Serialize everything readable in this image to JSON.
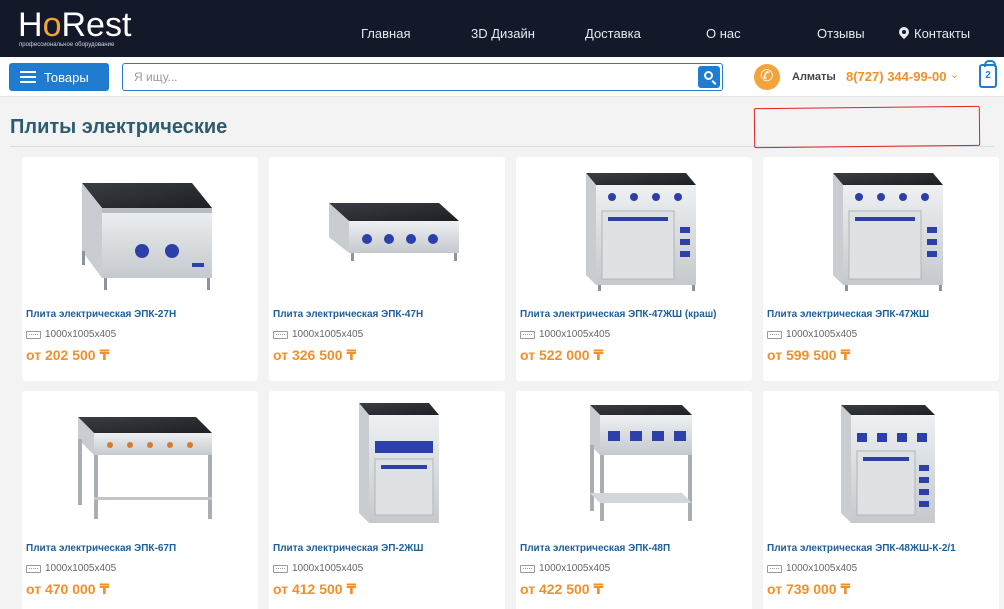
{
  "header": {
    "logo_text": "HoRest",
    "logo_subtitle": "профессиональное оборудование",
    "nav": [
      {
        "label": "Главная"
      },
      {
        "label": "3D Дизайн"
      },
      {
        "label": "Доставка"
      },
      {
        "label": "О нас"
      },
      {
        "label": "Отзывы"
      },
      {
        "label": "Контакты",
        "icon": "map-pin-icon"
      }
    ]
  },
  "toolbar": {
    "goods_label": "Товары",
    "search_placeholder": "Я ищу...",
    "city": "Алматы",
    "phone": "8(727) 344-99-00",
    "cart_count": "2"
  },
  "page": {
    "title": "Плиты электрические"
  },
  "products": [
    {
      "name": "Плита электрическая ЭПК-27Н",
      "dims": "1000х1005х405",
      "price": "от 202 500 ₸"
    },
    {
      "name": "Плита электрическая ЭПК-47Н",
      "dims": "1000х1005х405",
      "price": "от 326 500 ₸"
    },
    {
      "name": "Плита электрическая ЭПК-47ЖШ (краш)",
      "dims": "1000х1005х405",
      "price": "от 522 000 ₸"
    },
    {
      "name": "Плита электрическая ЭПК-47ЖШ",
      "dims": "1000х1005х405",
      "price": "от 599 500 ₸"
    },
    {
      "name": "Плита электрическая ЭПК-67П",
      "dims": "1000х1005х405",
      "price": "от 470 000 ₸"
    },
    {
      "name": "Плита электрическая ЭП-2ЖШ",
      "dims": "1000х1005х405",
      "price": "от 412 500 ₸"
    },
    {
      "name": "Плита электрическая ЭПК-48П",
      "dims": "1000х1005х405",
      "price": "от 422 500 ₸"
    },
    {
      "name": "Плита электрическая ЭПК-48ЖШ-К-2/1",
      "dims": "1000х1005х405",
      "price": "от 739 000 ₸"
    }
  ],
  "colors": {
    "header_bg": "#14192a",
    "accent_blue": "#1f7ccf",
    "price_orange": "#f0902a",
    "title_teal": "#2c5c6f"
  }
}
